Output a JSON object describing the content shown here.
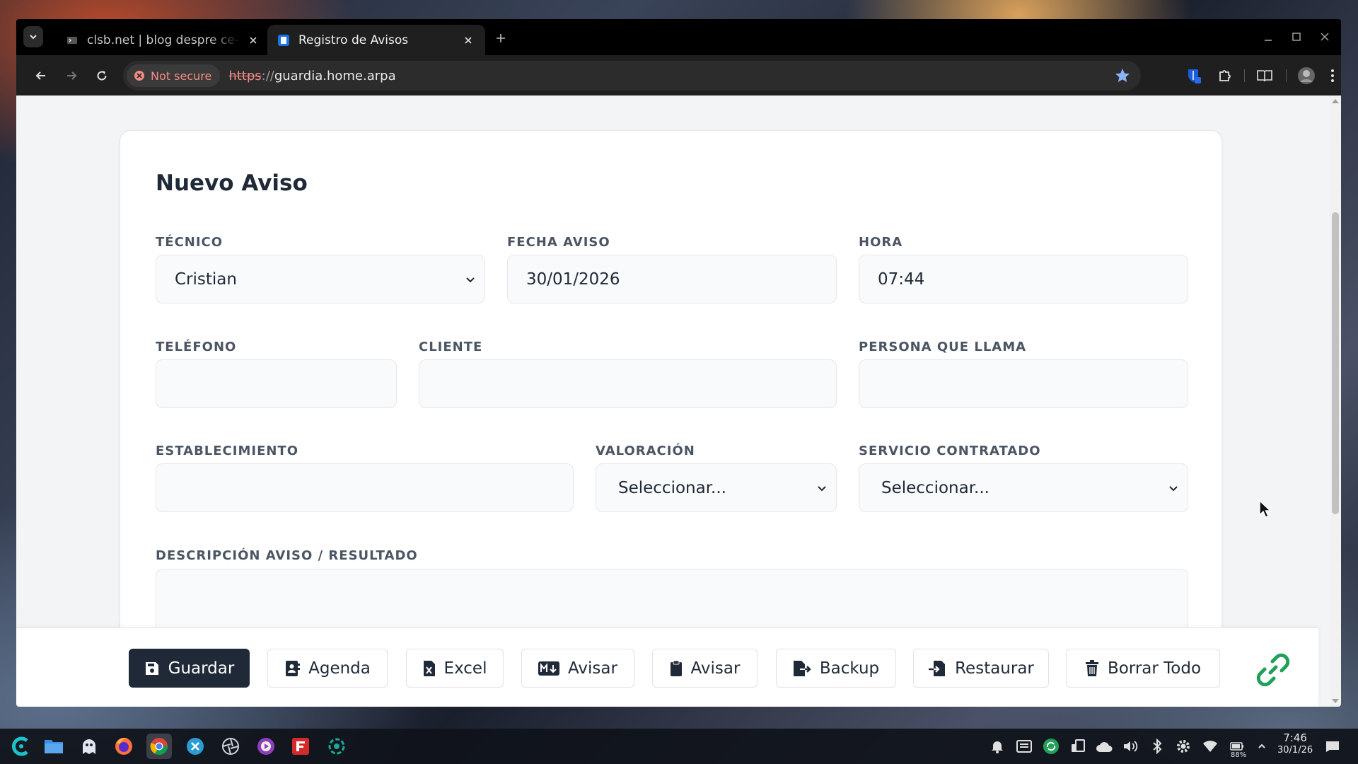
{
  "browser": {
    "tabs": [
      {
        "title": "clsb.net | blog despre ce-m",
        "active": false
      },
      {
        "title": "Registro de Avisos",
        "active": true
      }
    ],
    "security_label": "Not secure",
    "url_scheme": "https",
    "url_sep": "://",
    "url_host": "guardia.home.arpa"
  },
  "form": {
    "title": "Nuevo Aviso",
    "tecnico": {
      "label": "TÉCNICO",
      "value": "Cristian"
    },
    "fecha": {
      "label": "FECHA AVISO",
      "value": "30/01/2026"
    },
    "hora": {
      "label": "HORA",
      "value": "07:44"
    },
    "telefono": {
      "label": "TELÉFONO",
      "value": ""
    },
    "cliente": {
      "label": "CLIENTE",
      "value": ""
    },
    "persona": {
      "label": "PERSONA QUE LLAMA",
      "value": ""
    },
    "establecimiento": {
      "label": "ESTABLECIMIENTO",
      "value": ""
    },
    "valoracion": {
      "label": "VALORACIÓN",
      "value": "Seleccionar..."
    },
    "servicio": {
      "label": "SERVICIO CONTRATADO",
      "value": "Seleccionar..."
    },
    "descripcion": {
      "label": "DESCRIPCIÓN AVISO / RESULTADO",
      "value": ""
    }
  },
  "footer": {
    "guardar": "Guardar",
    "agenda": "Agenda",
    "excel": "Excel",
    "avisar_md": "Avisar",
    "avisar_clip": "Avisar",
    "backup": "Backup",
    "restaurar": "Restaurar",
    "borrar": "Borrar Todo"
  },
  "taskbar": {
    "time": "7:46",
    "date": "30/1/26",
    "battery": "88%"
  },
  "colors": {
    "primary_button": "#1f2937",
    "link_icon": "#22a05a",
    "not_secure": "#f28b82",
    "bookmark_star": "#8ab4f8"
  }
}
